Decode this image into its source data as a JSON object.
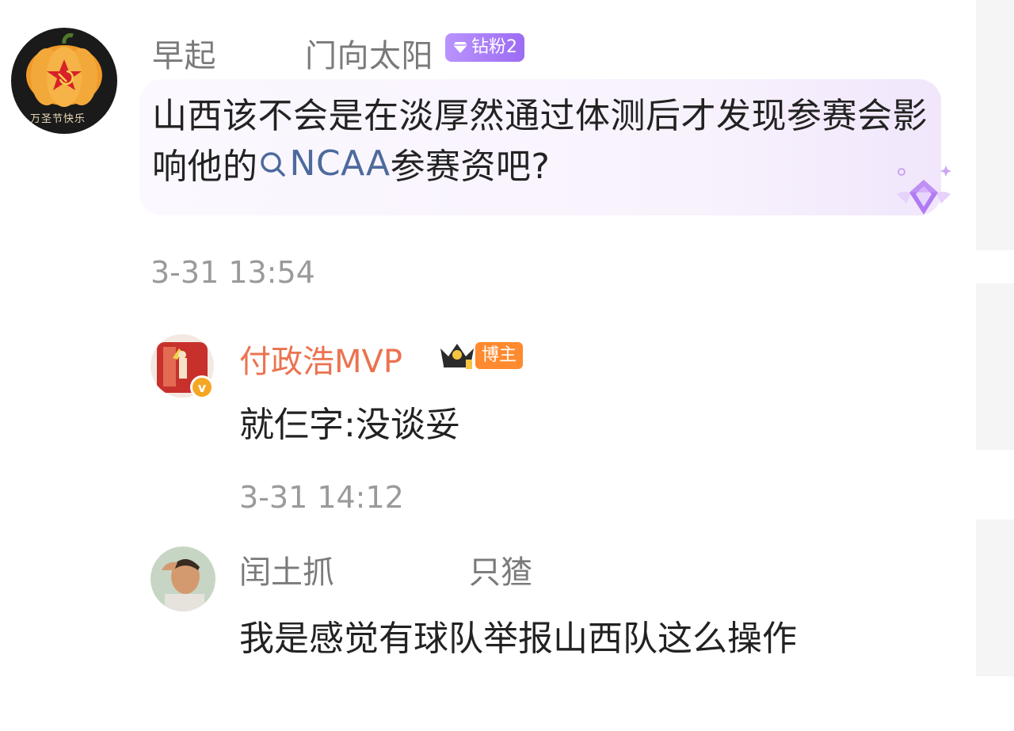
{
  "comment": {
    "author_part1": "早起",
    "author_part2": "门向太阳",
    "fan_badge": "钻粉2",
    "text_before_topic": "山西该不会是在淡厚然通过体测后才发现参赛会影响他的",
    "topic": "NCAA",
    "text_after_topic": "参赛资吧?",
    "time": "3-31 13:54",
    "avatar_text": "万圣节快乐"
  },
  "reply1": {
    "author": "付政浩MVP",
    "role_badge": "博主",
    "text": "就仨字:没谈妥",
    "time": "3-31 14:12"
  },
  "reply2": {
    "author_part1": "闰土抓",
    "author_part2": "只猹",
    "text": "我是感觉有球队举报山西队这么操作"
  },
  "colors": {
    "blogger_name": "#eb7350",
    "topic_link": "#4d6a9c",
    "fan_badge": "#9c6cf3",
    "blogger_badge": "#ff8a2f"
  }
}
